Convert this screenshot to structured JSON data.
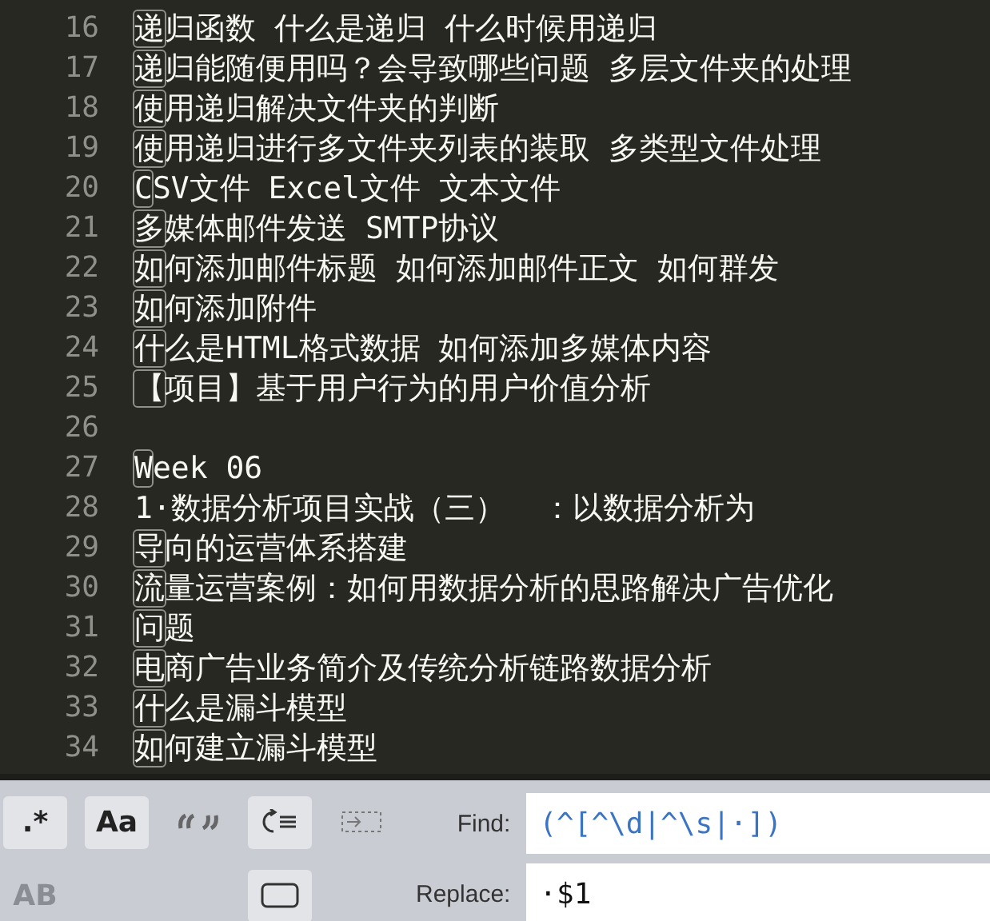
{
  "editor": {
    "lines": [
      {
        "number": "16",
        "match": "递",
        "rest": "归函数 什么是递归 什么时候用递归"
      },
      {
        "number": "17",
        "match": "递",
        "rest": "归能随便用吗？会导致哪些问题 多层文件夹的处理"
      },
      {
        "number": "18",
        "match": "使",
        "rest": "用递归解决文件夹的判断"
      },
      {
        "number": "19",
        "match": "使",
        "rest": "用递归进行多文件夹列表的装取 多类型文件处理"
      },
      {
        "number": "20",
        "match": "C",
        "rest": "SV文件 Excel文件 文本文件"
      },
      {
        "number": "21",
        "match": "多",
        "rest": "媒体邮件发送 SMTP协议"
      },
      {
        "number": "22",
        "match": "如",
        "rest": "何添加邮件标题 如何添加邮件正文 如何群发"
      },
      {
        "number": "23",
        "match": "如",
        "rest": "何添加附件"
      },
      {
        "number": "24",
        "match": "什",
        "rest": "么是HTML格式数据 如何添加多媒体内容"
      },
      {
        "number": "25",
        "match": "【",
        "rest": "项目】基于用户行为的用户价值分析"
      },
      {
        "number": "26"
      },
      {
        "number": "27",
        "match": "W",
        "rest": "eek 06"
      },
      {
        "number": "28",
        "rest": "1·数据分析项目实战（三）  ：以数据分析为"
      },
      {
        "number": "29",
        "match": "导",
        "rest": "向的运营体系搭建"
      },
      {
        "number": "30",
        "match": "流",
        "rest": "量运营案例：如何用数据分析的思路解决广告优化"
      },
      {
        "number": "31",
        "match": "问",
        "rest": "题"
      },
      {
        "number": "32",
        "match": "电",
        "rest": "商广告业务简介及传统分析链路数据分析"
      },
      {
        "number": "33",
        "match": "什",
        "rest": "么是漏斗模型"
      },
      {
        "number": "34",
        "match": "如",
        "rest": "何建立漏斗模型"
      }
    ]
  },
  "find_panel": {
    "toggles": [
      {
        "kind": "text",
        "label": ".*",
        "selected": true,
        "disabled": false
      },
      {
        "kind": "text",
        "label": "Aa",
        "selected": true,
        "disabled": false
      },
      {
        "kind": "quotes",
        "selected": false
      },
      {
        "kind": "wrap",
        "selected": true
      },
      {
        "kind": "in-selection",
        "selected": false
      },
      {
        "kind": "text",
        "label": "AB",
        "selected": false,
        "disabled": true
      },
      {
        "kind": "spacer"
      },
      {
        "kind": "spacer"
      },
      {
        "kind": "highlight",
        "selected": true
      }
    ],
    "find": {
      "label": "Find:",
      "value": "(^[^\\d|^\\s|·])"
    },
    "replace": {
      "label": "Replace:",
      "value": "·$1"
    }
  }
}
